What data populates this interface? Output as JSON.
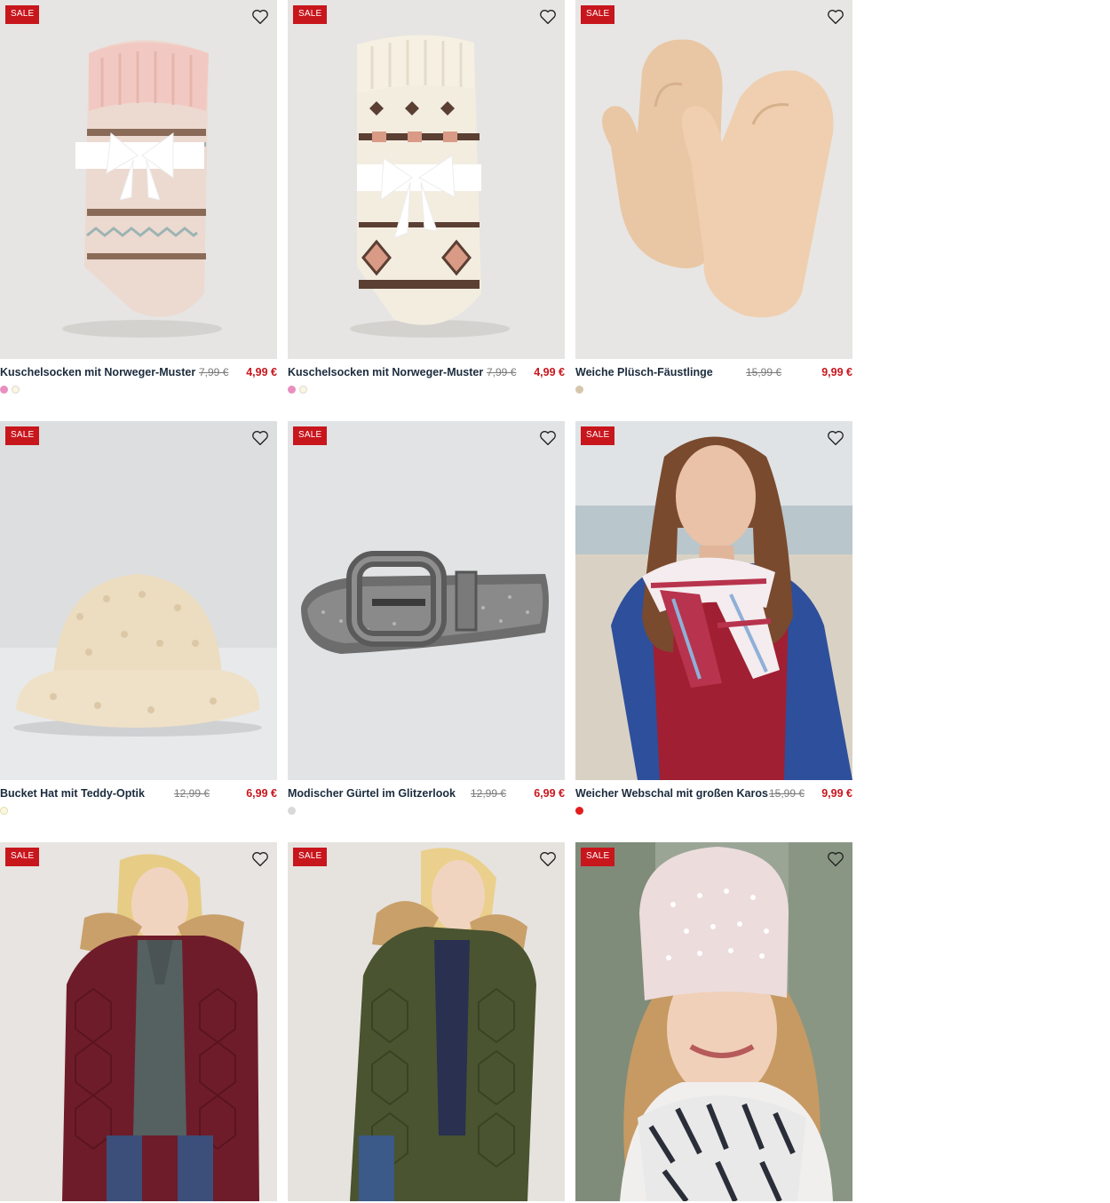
{
  "colors": {
    "sale_bg": "#c8161d",
    "new_price": "#c8161d",
    "old_price": "#7a7a7a",
    "title": "#1b2b3d"
  },
  "products": [
    {
      "badge": "SALE",
      "name": "Kuschelsocken mit Norweger-Muster",
      "old_price": "7,99 €",
      "new_price": "4,99 €",
      "image": "pink-nordic-socks",
      "swatches": [
        "#e88fc0",
        "#fbf6e4"
      ]
    },
    {
      "badge": "SALE",
      "name": "Kuschelsocken mit Norweger-Muster",
      "old_price": "7,99 €",
      "new_price": "4,99 €",
      "image": "cream-nordic-socks",
      "swatches": [
        "#e88fc0",
        "#fbf6e4"
      ]
    },
    {
      "badge": "SALE",
      "name": "Weiche Plüsch-Fäustlinge",
      "old_price": "15,99 €",
      "new_price": "9,99 €",
      "image": "plush-mittens",
      "swatches": [
        "#d6c6ac"
      ]
    },
    {
      "badge": "SALE",
      "name": "Bucket Hat mit Teddy-Optik",
      "old_price": "12,99 €",
      "new_price": "6,99 €",
      "image": "teddy-bucket-hat",
      "swatches": [
        "#fbf6e4"
      ]
    },
    {
      "badge": "SALE",
      "name": "Modischer Gürtel im Glitzerlook",
      "old_price": "12,99 €",
      "new_price": "6,99 €",
      "image": "glitter-belt",
      "swatches": [
        "#d9d9d9"
      ]
    },
    {
      "badge": "SALE",
      "name": "Weicher Webschal mit großen Karos",
      "old_price": "15,99 €",
      "new_price": "9,99 €",
      "image": "checked-scarf-model",
      "swatches": [
        "#e11d1d"
      ]
    },
    {
      "badge": "SALE",
      "name": "",
      "old_price": "",
      "new_price": "",
      "image": "burgundy-quilted-coat",
      "swatches": []
    },
    {
      "badge": "SALE",
      "name": "",
      "old_price": "",
      "new_price": "",
      "image": "olive-quilted-coat",
      "swatches": []
    },
    {
      "badge": "SALE",
      "name": "",
      "old_price": "",
      "new_price": "",
      "image": "pearl-beanie-model",
      "swatches": []
    }
  ]
}
